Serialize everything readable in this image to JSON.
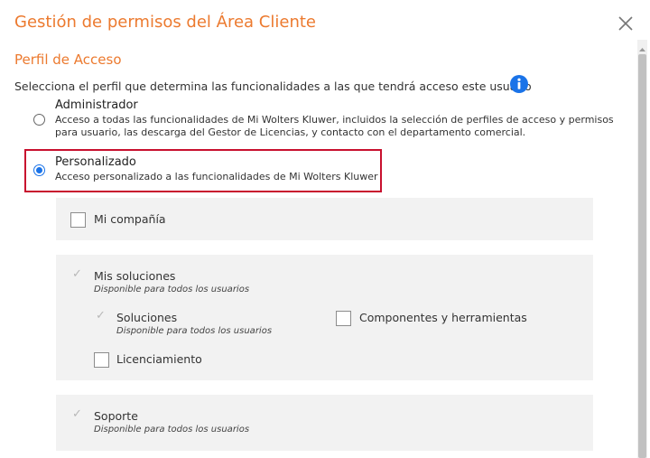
{
  "dialog": {
    "title": "Gestión de permisos del Área Cliente",
    "close_icon": "close-icon"
  },
  "access_profile": {
    "section_title": "Perfil de Acceso",
    "description": "Selecciona el perfil que determina las funcionalidades a las que tendrá acceso este usuario",
    "info_icon": "info-icon",
    "options": [
      {
        "label": "Administrador",
        "description_line1": "Acceso a todas las funcionalidades de Mi Wolters Kluwer, incluidos la selección de perfiles de acceso y permisos",
        "description_line2": "para usuario, las descarga del Gestor de Licencias, y contacto con el departamento comercial.",
        "selected": false
      },
      {
        "label": "Personalizado",
        "description": "Acceso personalizado a las funcionalidades de Mi Wolters Kluwer",
        "selected": true
      }
    ]
  },
  "permissions": {
    "mi_compania": {
      "label": "Mi compañía",
      "checked": false
    },
    "mis_soluciones": {
      "label": "Mis soluciones",
      "subtitle": "Disponible para todos los usuarios",
      "checked": true,
      "disabled": true,
      "children": {
        "soluciones": {
          "label": "Soluciones",
          "subtitle": "Disponible para todos los usuarios",
          "checked": true,
          "disabled": true
        },
        "componentes": {
          "label": "Componentes y herramientas",
          "checked": false
        },
        "licenciamiento": {
          "label": "Licenciamiento",
          "checked": false
        }
      }
    },
    "soporte": {
      "label": "Soporte",
      "subtitle": "Disponible para todos los usuarios",
      "checked": true,
      "disabled": true
    }
  },
  "colors": {
    "accent_orange": "#ec7a2f",
    "info_blue": "#1a73e8",
    "highlight_red": "#c8102e",
    "panel_gray": "#f2f2f2"
  }
}
